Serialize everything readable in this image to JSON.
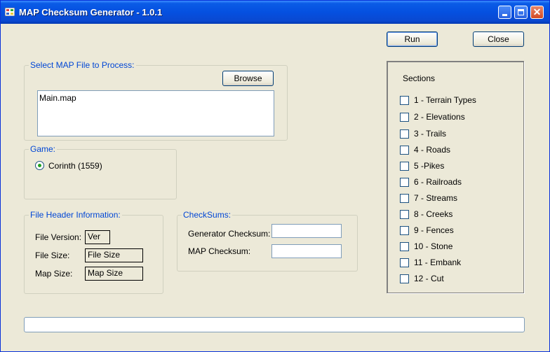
{
  "window": {
    "title": "MAP Checksum Generator - 1.0.1",
    "controls": {
      "close_glyph": "✕"
    }
  },
  "toolbar": {
    "run_label": "Run",
    "close_label": "Close"
  },
  "map_file": {
    "legend": "Select MAP File to Process:",
    "browse_label": "Browse",
    "value": "Main.map"
  },
  "game": {
    "legend": "Game:",
    "options": [
      {
        "label": "Corinth (1559)",
        "selected": true
      }
    ]
  },
  "file_header": {
    "legend": "File Header Information:",
    "rows": [
      {
        "label": "File Version:",
        "value": "Ver"
      },
      {
        "label": "File Size:",
        "value": "File Size"
      },
      {
        "label": "Map Size:",
        "value": "Map Size"
      }
    ]
  },
  "checksums": {
    "legend": "CheckSums:",
    "generator_label": "Generator Checksum:",
    "generator_value": "",
    "map_label": "MAP Checksum:",
    "map_value": ""
  },
  "sections": {
    "title": "Sections",
    "items": [
      {
        "label": "1 - Terrain Types",
        "checked": false
      },
      {
        "label": "2 - Elevations",
        "checked": false
      },
      {
        "label": "3 - Trails",
        "checked": false
      },
      {
        "label": "4 - Roads",
        "checked": false
      },
      {
        "label": "5 -Pikes",
        "checked": false
      },
      {
        "label": "6 - Railroads",
        "checked": false
      },
      {
        "label": "7 - Streams",
        "checked": false
      },
      {
        "label": "8 - Creeks",
        "checked": false
      },
      {
        "label": "9 - Fences",
        "checked": false
      },
      {
        "label": "10 - Stone",
        "checked": false
      },
      {
        "label": "11 - Embank",
        "checked": false
      },
      {
        "label": "12 - Cut",
        "checked": false
      }
    ]
  },
  "progress": {
    "value": 0
  },
  "colors": {
    "title_bar": "#0550e0",
    "face": "#ece9d8",
    "group_legend": "#0046d5",
    "radio_dot": "#21a121"
  },
  "icons": {
    "app": "app-icon",
    "minimize": "minimize-icon",
    "maximize": "maximize-icon",
    "close": "close-icon"
  }
}
